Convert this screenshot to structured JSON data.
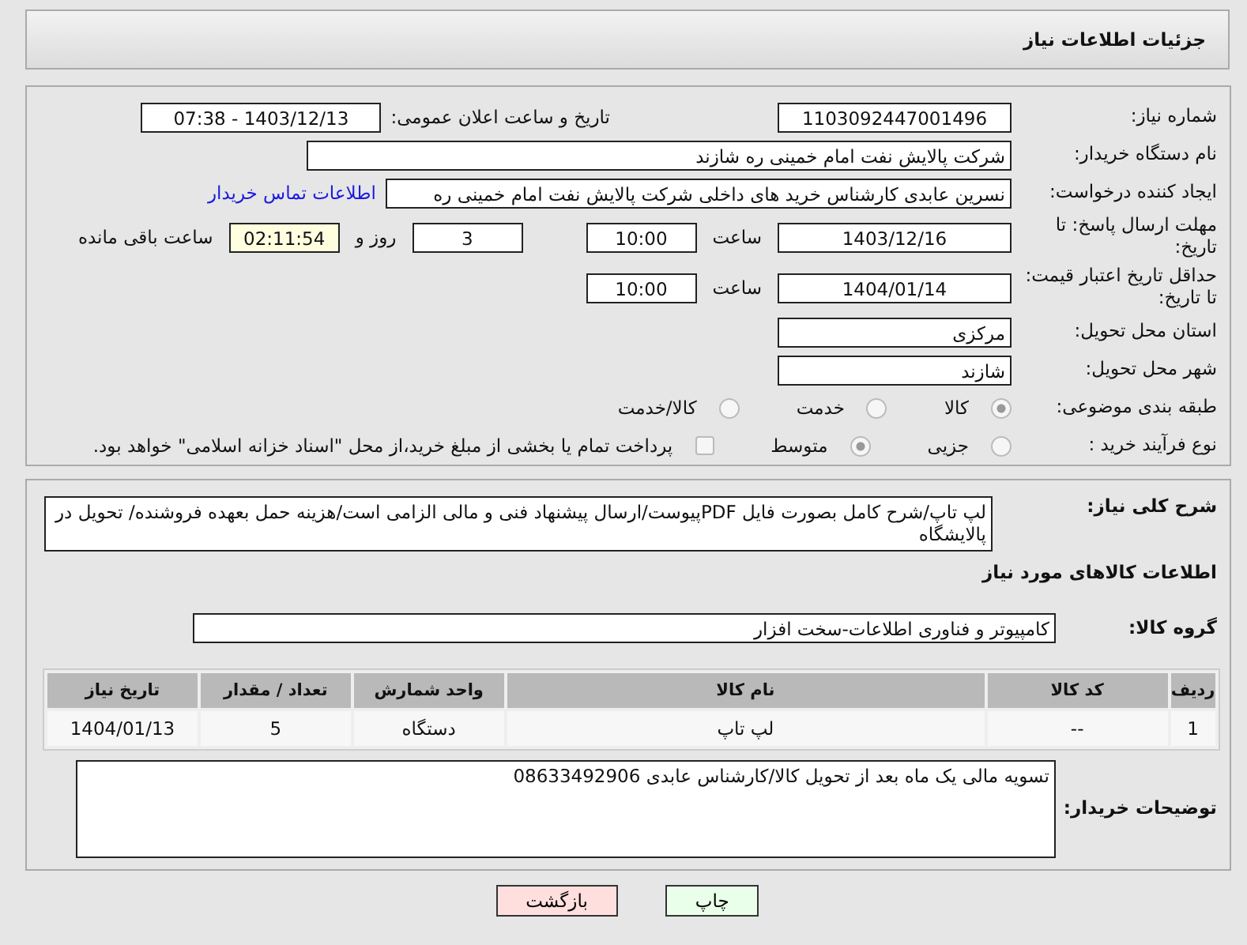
{
  "title": "جزئیات اطلاعات نیاز",
  "need_number": {
    "label": "شماره نیاز:",
    "value": "1103092447001496"
  },
  "announce_date": {
    "label": "تاریخ و ساعت اعلان عمومی:",
    "value": "1403/12/13 - 07:38"
  },
  "buyer_org": {
    "label": "نام دستگاه خریدار:",
    "value": "شرکت پالایش نفت امام خمینی  ره  شازند"
  },
  "requester": {
    "label": "ایجاد کننده درخواست:",
    "value": "نسرین عابدی کارشناس خرید های داخلی  شرکت پالایش نفت امام خمینی  ره",
    "link": "اطلاعات تماس خریدار"
  },
  "reply_deadline": {
    "label": "مهلت ارسال پاسخ: تا تاریخ:",
    "date": "1403/12/16",
    "time_label": "ساعت",
    "time": "10:00",
    "days": "3",
    "days_label": "روز و",
    "remaining": "02:11:54",
    "remaining_label": "ساعت باقی مانده"
  },
  "price_validity": {
    "label": "حداقل تاریخ اعتبار قیمت: تا تاریخ:",
    "date": "1404/01/14",
    "time_label": "ساعت",
    "time": "10:00"
  },
  "province": {
    "label": "استان محل تحویل:",
    "value": "مرکزی"
  },
  "city": {
    "label": "شهر محل تحویل:",
    "value": "شازند"
  },
  "category": {
    "label": "طبقه بندی موضوعی:",
    "options": [
      {
        "label": "کالا",
        "selected": true
      },
      {
        "label": "خدمت",
        "selected": false
      },
      {
        "label": "کالا/خدمت",
        "selected": false
      }
    ]
  },
  "process": {
    "label": "نوع فرآیند خرید :",
    "options": [
      {
        "label": "جزیی",
        "selected": false
      },
      {
        "label": "متوسط",
        "selected": true
      }
    ],
    "payment": {
      "label": "پرداخت تمام یا بخشی از مبلغ خرید،از محل \"اسناد خزانه اسلامی\" خواهد بود.",
      "checked": false
    }
  },
  "description": {
    "label": "شرح کلی نیاز:",
    "value": "لپ تاپ/شرح کامل بصورت فایل PDFپیوست/ارسال پیشنهاد فنی و مالی الزامی است/هزینه حمل بعهده فروشنده/ تحویل در پالایشگاه"
  },
  "goods_heading": "اطلاعات کالاهای مورد نیاز",
  "goods_group": {
    "label": "گروه کالا:",
    "value": "کامپیوتر و فناوری اطلاعات-سخت افزار"
  },
  "table": {
    "columns": [
      "ردیف",
      "کد کالا",
      "نام کالا",
      "واحد شمارش",
      "تعداد / مقدار",
      "تاریخ نیاز"
    ],
    "rows": [
      [
        "1",
        "--",
        "لپ تاپ",
        "دستگاه",
        "5",
        "1404/01/13"
      ]
    ]
  },
  "buyer_notes": {
    "label": "توضیحات خریدار:",
    "value": "تسویه مالی یک ماه بعد از تحویل کالا/کارشناس عابدی 08633492906"
  },
  "buttons": [
    {
      "label": "چاپ",
      "kind": "print"
    },
    {
      "label": "بازگشت",
      "kind": "back"
    }
  ]
}
